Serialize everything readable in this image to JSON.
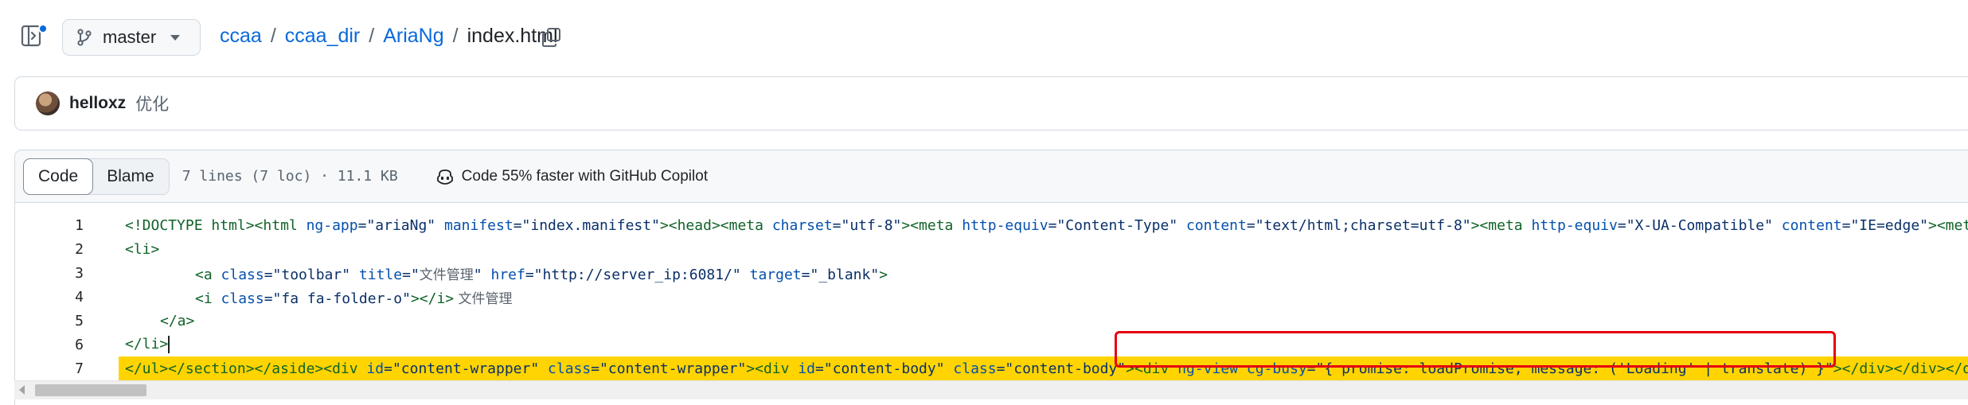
{
  "header": {
    "branch": "master",
    "breadcrumb": {
      "owner": "ccaa",
      "dir": "ccaa_dir",
      "subdir": "AriaNg",
      "file": "index.html",
      "separator": "/"
    }
  },
  "commit": {
    "author": "helloxz",
    "message": "优化"
  },
  "file_header": {
    "tab_code": "Code",
    "tab_blame": "Blame",
    "meta": "7 lines (7 loc) · 11.1 KB",
    "copilot": "Code 55% faster with GitHub Copilot"
  },
  "code": {
    "line_numbers": [
      "1",
      "2",
      "3",
      "4",
      "5",
      "6",
      "7"
    ],
    "line1": {
      "a": "<!DOCTYPE html><html ",
      "b": "ng-app",
      "c": "=\"ariaNg\" ",
      "d": "manifest",
      "e": "=\"index.manifest\"",
      "f": "><head><meta ",
      "g": "charset",
      "h": "=\"utf-8\"",
      "i": "><meta ",
      "j": "http-equiv",
      "k": "=\"Content-Type\" ",
      "l": "content",
      "m": "=\"text/html;charset=utf-8\"",
      "n": "><meta ",
      "o": "http-equiv",
      "p": "=\"X-UA-Compatible\" ",
      "q": "content",
      "r": "=\"IE=edge\"",
      "s": "><met"
    },
    "line2": "<li>",
    "line3": {
      "a": "<a ",
      "b": "class",
      "c": "=\"toolbar\" ",
      "d": "title",
      "e": "=\"",
      "f": "文件管理",
      "g": "\" ",
      "h": "href",
      "i": "=\"http://server_ip:6081/\" ",
      "j": "target",
      "k": "=\"_blank\"",
      "l": ">"
    },
    "line4": {
      "a": "<i ",
      "b": "class",
      "c": "=\"fa fa-folder-o\"",
      "d": "></i>",
      "e": " 文件管理"
    },
    "line5": "</a>",
    "line6": "</li>",
    "line7": {
      "a": "</ul></section></aside><div ",
      "b": "id",
      "c": "=\"content-wrapper\" ",
      "d": "class",
      "e": "=\"content-wrapper\"",
      "f": "><div ",
      "g": "id",
      "h": "=\"content-body\" ",
      "i": "class",
      "j": "=\"content-body\"",
      "k": "><div ",
      "l": "ng-view ",
      "m": "cg-busy",
      "n": "=\"{ promise: loadPromise, message: ('Loading' | translate) }\"",
      "o": "></div></div></d"
    }
  },
  "colors": {
    "link": "#0969da",
    "highlight": "#ffd400",
    "annotation_box": "#e6000f"
  }
}
